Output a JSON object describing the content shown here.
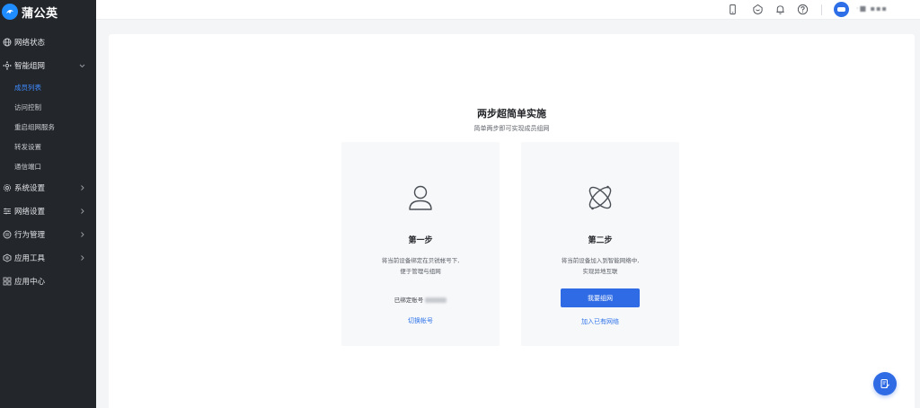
{
  "brand": {
    "name": "蒲公英"
  },
  "sidebar": {
    "items": [
      {
        "label": "网络状态"
      },
      {
        "label": "智能组网"
      },
      {
        "label": "系统设置"
      },
      {
        "label": "网络设置"
      },
      {
        "label": "行为管理"
      },
      {
        "label": "应用工具"
      },
      {
        "label": "应用中心"
      }
    ],
    "subitems": [
      {
        "label": "成员列表"
      },
      {
        "label": "访问控制"
      },
      {
        "label": "重启组网服务"
      },
      {
        "label": "转发设置"
      },
      {
        "label": "通信端口"
      }
    ]
  },
  "topbar": {
    "username": "·■ ▪▪▪"
  },
  "main": {
    "title": "两步超简单实施",
    "subtitle": "简单两步即可实现成员组网",
    "step1": {
      "title": "第一步",
      "desc_line1": "将当前设备绑定在贝锐帐号下,",
      "desc_line2": "便于管理与组网",
      "bound_label": "已绑定账号",
      "switch_link": "切换帐号"
    },
    "step2": {
      "title": "第二步",
      "desc_line1": "将当前设备加入到智能网络中,",
      "desc_line2": "实现异地互联",
      "button": "我要组网",
      "join_link": "加入已有网络"
    }
  },
  "colors": {
    "accent": "#2f6be4",
    "sidebar_bg": "#23262b",
    "active": "#3f8cff"
  }
}
